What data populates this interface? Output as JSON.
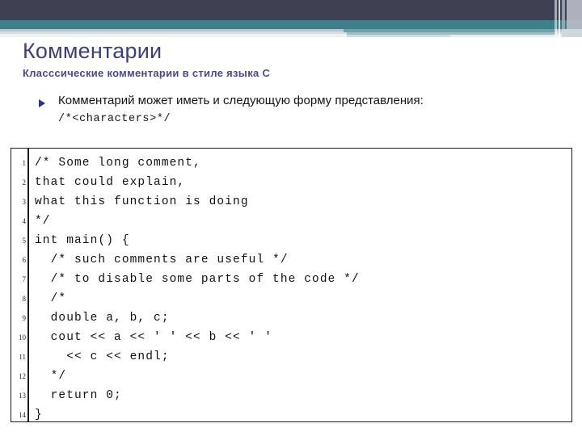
{
  "slide": {
    "title": "Комментарии",
    "subtitle": "Класссические комментарии в стиле языка С",
    "bullet": {
      "marker": "triangle-bullet-icon",
      "text": "Комментарий может иметь и следующую форму представления:",
      "code_form": "/*<characters>*/"
    },
    "colors": {
      "header_dark": "#3f4052",
      "header_teal": "#3d8089",
      "title": "#3f3e7d",
      "subtitle": "#4a4793",
      "bullet": "#2b2f9e",
      "code_border": "#1a1a1a",
      "code_text": "#111111"
    }
  },
  "code_block": {
    "line_numbers": [
      "1",
      "2",
      "3",
      "4",
      "5",
      "6",
      "7",
      "8",
      "9",
      "10",
      "11",
      "12",
      "13",
      "14"
    ],
    "lines": [
      "/* Some long comment,",
      "that could explain,",
      "what this function is doing",
      "*/",
      "int main() {",
      "  /* such comments are useful */",
      "  /* to disable some parts of the code */",
      "  /*",
      "  double a, b, c;",
      "  cout << a << ' ' << b << ' '",
      "    << c << endl;",
      "  */",
      "  return 0;",
      "}"
    ]
  }
}
